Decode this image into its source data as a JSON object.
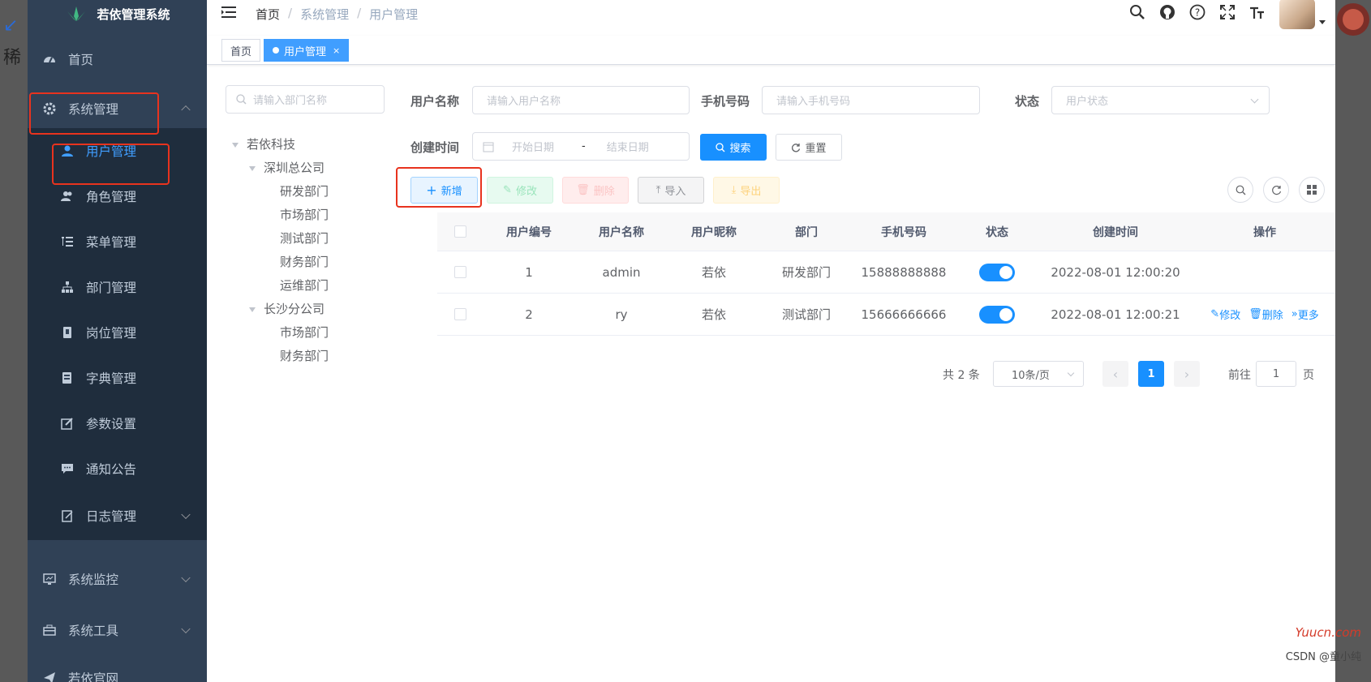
{
  "app": {
    "title": "若依管理系统"
  },
  "sidebar": {
    "home": "首页",
    "system": "系统管理",
    "sub_items": [
      "用户管理",
      "角色管理",
      "菜单管理",
      "部门管理",
      "岗位管理",
      "字典管理",
      "参数设置",
      "通知公告",
      "日志管理"
    ],
    "monitor": "系统监控",
    "tools": "系统工具",
    "website": "若依官网"
  },
  "navbar": {
    "breadcrumb": [
      "首页",
      "系统管理",
      "用户管理"
    ]
  },
  "tags": [
    "首页",
    "用户管理"
  ],
  "tree": {
    "placeholder": "请输入部门名称",
    "nodes": [
      "若依科技",
      "深圳总公司",
      "研发部门",
      "市场部门",
      "测试部门",
      "财务部门",
      "运维部门",
      "长沙分公司",
      "市场部门",
      "财务部门"
    ]
  },
  "search": {
    "username_label": "用户名称",
    "username_placeholder": "请输入用户名称",
    "phone_label": "手机号码",
    "phone_placeholder": "请输入手机号码",
    "status_label": "状态",
    "status_placeholder": "用户状态",
    "created_label": "创建时间",
    "start_placeholder": "开始日期",
    "date_sep": "-",
    "end_placeholder": "结束日期",
    "search_btn": "搜索",
    "reset_btn": "重置"
  },
  "toolbar": {
    "add": "新增",
    "edit": "修改",
    "delete": "删除",
    "import": "导入",
    "export": "导出"
  },
  "table": {
    "headers": [
      "用户编号",
      "用户名称",
      "用户昵称",
      "部门",
      "手机号码",
      "状态",
      "创建时间",
      "操作"
    ],
    "rows": [
      {
        "id": "1",
        "username": "admin",
        "nickname": "若依",
        "dept": "研发部门",
        "phone": "15888888888",
        "status_on": true,
        "created": "2022-08-01 12:00:20"
      },
      {
        "id": "2",
        "username": "ry",
        "nickname": "若依",
        "dept": "测试部门",
        "phone": "15666666666",
        "status_on": true,
        "created": "2022-08-01 12:00:21"
      }
    ],
    "actions": [
      "修改",
      "删除",
      "更多"
    ]
  },
  "pagination": {
    "total": "共 2 条",
    "page_size": "10条/页",
    "current": "1",
    "goto_label": "前往",
    "goto_value": "1",
    "page_unit": "页"
  },
  "watermark": {
    "site": "Yuucn.com",
    "author": "CSDN @童小纯"
  },
  "backdrop_left_char": "稀"
}
